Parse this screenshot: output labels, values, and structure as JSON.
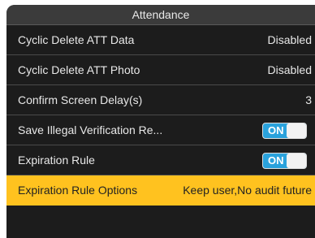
{
  "header": {
    "title": "Attendance"
  },
  "rows": [
    {
      "label": "Cyclic Delete ATT Data",
      "value": "Disabled"
    },
    {
      "label": "Cyclic Delete ATT Photo",
      "value": "Disabled"
    },
    {
      "label": "Confirm Screen Delay(s)",
      "value": "3"
    },
    {
      "label": "Save Illegal Verification Re...",
      "toggle": "ON"
    },
    {
      "label": "Expiration Rule",
      "toggle": "ON"
    },
    {
      "label": "Expiration Rule Options",
      "value": "Keep user,No audit future"
    }
  ],
  "colors": {
    "selected_row": "#ffc21f",
    "toggle_on": "#2aa2dc",
    "background": "#1c1c1c"
  }
}
